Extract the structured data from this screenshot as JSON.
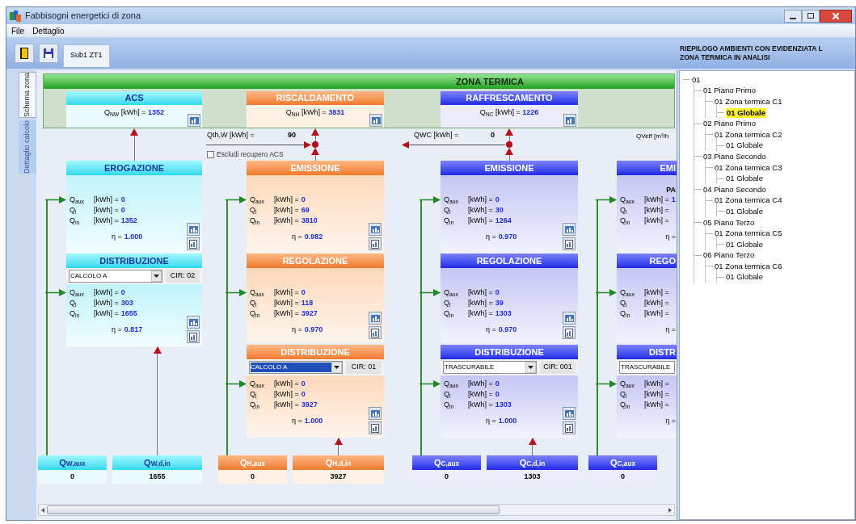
{
  "window": {
    "title": "Fabbisogni energetici di zona"
  },
  "menu": [
    "File",
    "Dettaglio"
  ],
  "toolbar": {
    "tabs": [
      {
        "label": "Sub1 ZT1",
        "selected": true
      }
    ]
  },
  "tree_title": [
    "RIEPILOGO AMBIENTI CON EVIDENZIATA L",
    "ZONA TERMICA IN ANALISI"
  ],
  "side_tabs": [
    {
      "label": "Schema zona",
      "selected": true
    },
    {
      "label": "Dettaglio calcolo",
      "selected": false
    }
  ],
  "zone_header": "ZONA TERMICA",
  "links": {
    "heating": {
      "label": "Qth,W [kWh] =",
      "value": "90"
    },
    "cooling": {
      "label": "QWC [kWh] =",
      "value": "0"
    },
    "ventilation": {
      "label": "QVeff [m³/h"
    }
  },
  "exclude_checkbox": {
    "label": "Escludi recupero ACS",
    "checked": false
  },
  "columns": [
    {
      "kind": "acs",
      "summary": {
        "title": "ACS",
        "label": "Q$_{NW}$ [kWh] =",
        "value": "1352"
      },
      "sections": [
        {
          "title": "EROGAZIONE",
          "rows": [
            {
              "q": "Q$_{aux}$",
              "unit": "[kWh] =",
              "value": "0"
            },
            {
              "q": "Q$_{l}$",
              "unit": "[kWh] =",
              "value": "0"
            },
            {
              "q": "Q$_{in}$",
              "unit": "[kWh] =",
              "value": "1352"
            }
          ],
          "eta": {
            "label": "η =",
            "value": "1.000"
          }
        },
        {
          "title": "DISTRIBUZIONE",
          "select": {
            "value": "CALCOLO A",
            "highlighted": false
          },
          "circuit": "CIR: 02",
          "rows": [
            {
              "q": "Q$_{aux}$",
              "unit": "[kWh] =",
              "value": "0"
            },
            {
              "q": "Q$_{l}$",
              "unit": "[kWh] =",
              "value": "303"
            },
            {
              "q": "Q$_{in}$",
              "unit": "[kWh] =",
              "value": "1655"
            }
          ],
          "eta": {
            "label": "η =",
            "value": "0.817"
          }
        }
      ],
      "totals": [
        {
          "label": "Q$_{W,aux}$",
          "value": "0"
        },
        {
          "label": "Q$_{W,d,in}$",
          "value": "1655"
        }
      ]
    },
    {
      "kind": "heating",
      "summary": {
        "title": "RISCALDAMENTO",
        "label": "Q$_{NH}$ [kWh] =",
        "value": "3831"
      },
      "sections": [
        {
          "title": "EMISSIONE",
          "rows": [
            {
              "q": "Q$_{aux}$",
              "unit": "[kWh] =",
              "value": "0"
            },
            {
              "q": "Q$_{l}$",
              "unit": "[kWh] =",
              "value": "69"
            },
            {
              "q": "Q$_{in}$",
              "unit": "[kWh] =",
              "value": "3810"
            }
          ],
          "eta": {
            "label": "η =",
            "value": "0.982"
          }
        },
        {
          "title": "REGOLAZIONE",
          "rows": [
            {
              "q": "Q$_{aux}$",
              "unit": "[kWh] =",
              "value": "0"
            },
            {
              "q": "Q$_{l}$",
              "unit": "[kWh] =",
              "value": "118"
            },
            {
              "q": "Q$_{in}$",
              "unit": "[kWh] =",
              "value": "3927"
            }
          ],
          "eta": {
            "label": "η =",
            "value": "0.970"
          }
        },
        {
          "title": "DISTRIBUZIONE",
          "select": {
            "value": "CALCOLO A",
            "highlighted": true
          },
          "circuit": "CIR: 01",
          "rows": [
            {
              "q": "Q$_{aux}$",
              "unit": "[kWh] =",
              "value": "0"
            },
            {
              "q": "Q$_{l}$",
              "unit": "[kWh] =",
              "value": "0"
            },
            {
              "q": "Q$_{in}$",
              "unit": "[kWh] =",
              "value": "3927"
            }
          ],
          "eta": {
            "label": "η =",
            "value": "1.000"
          }
        }
      ],
      "totals": [
        {
          "label": "Q$_{H,aux}$",
          "value": "0"
        },
        {
          "label": "Q$_{H,d,in}$",
          "value": "3927"
        }
      ]
    },
    {
      "kind": "cooling",
      "summary": {
        "title": "RAFFRESCAMENTO",
        "label": "Q$_{NC}$ [kWh] =",
        "value": "1226"
      },
      "sections": [
        {
          "title": "EMISSIONE",
          "rows": [
            {
              "q": "Q$_{aux}$",
              "unit": "[kWh] =",
              "value": "0"
            },
            {
              "q": "Q$_{l}$",
              "unit": "[kWh] =",
              "value": "30"
            },
            {
              "q": "Q$_{in}$",
              "unit": "[kWh] =",
              "value": "1264"
            }
          ],
          "eta": {
            "label": "η =",
            "value": "0.970"
          }
        },
        {
          "title": "REGOLAZIONE",
          "rows": [
            {
              "q": "Q$_{aux}$",
              "unit": "[kWh] =",
              "value": "0"
            },
            {
              "q": "Q$_{l}$",
              "unit": "[kWh] =",
              "value": "39"
            },
            {
              "q": "Q$_{in}$",
              "unit": "[kWh] =",
              "value": "1303"
            }
          ],
          "eta": {
            "label": "η =",
            "value": "0.970"
          }
        },
        {
          "title": "DISTRIBUZIONE",
          "select": {
            "value": "TRASCURABILE",
            "highlighted": false
          },
          "circuit": "CIR: 001",
          "rows": [
            {
              "q": "Q$_{aux}$",
              "unit": "[kWh] =",
              "value": "0"
            },
            {
              "q": "Q$_{l}$",
              "unit": "[kWh] =",
              "value": "0"
            },
            {
              "q": "Q$_{in}$",
              "unit": "[kWh] =",
              "value": "1303"
            }
          ],
          "eta": {
            "label": "η =",
            "value": "1.000"
          }
        }
      ],
      "totals": [
        {
          "label": "Q$_{C,aux}$",
          "value": "0"
        },
        {
          "label": "Q$_{C,d,in}$",
          "value": "1303"
        }
      ]
    },
    {
      "kind": "cooling",
      "sections": [
        {
          "title": "EMI",
          "note": "PA",
          "rows": [
            {
              "q": "Q$_{aux}$",
              "unit": "[kWh] =",
              "value": "1"
            },
            {
              "q": "Q$_{l}$",
              "unit": "[kWh] ="
            },
            {
              "q": "Q$_{in}$",
              "unit": "[kWh] ="
            }
          ],
          "eta": {
            "label": "η ="
          }
        },
        {
          "title": "REGO",
          "rows": [
            {
              "q": "Q$_{aux}$",
              "unit": "[kWh] ="
            },
            {
              "q": "Q$_{l}$",
              "unit": "[kWh] ="
            },
            {
              "q": "Q$_{in}$",
              "unit": "[kWh] ="
            }
          ],
          "eta": {
            "label": "η ="
          }
        },
        {
          "title": "DISTR",
          "select": {
            "value": "TRASCURABILE",
            "highlighted": false
          },
          "rows": [
            {
              "q": "Q$_{aux}$",
              "unit": "[kWh] ="
            },
            {
              "q": "Q$_{l}$",
              "unit": "[kWh] ="
            },
            {
              "q": "Q$_{in}$",
              "unit": "[kWh] ="
            }
          ],
          "eta": {
            "label": "η ="
          }
        }
      ],
      "totals": [
        {
          "label": "Q$_{C,aux}$",
          "value": "0"
        }
      ]
    }
  ],
  "tree": [
    {
      "label": "01",
      "selected": false,
      "children": [
        {
          "label": "01 Piano Primo",
          "selected": false,
          "children": [
            {
              "label": "01 Zona termica C1",
              "selected": false,
              "children": [
                {
                  "label": "01 Globale",
                  "selected": true
                }
              ]
            }
          ]
        },
        {
          "label": "02 Piano Primo",
          "selected": false,
          "children": [
            {
              "label": "01 Zona termica C2",
              "selected": false,
              "children": [
                {
                  "label": "01 Globale",
                  "selected": false
                }
              ]
            }
          ]
        },
        {
          "label": "03 Piano Secondo",
          "selected": false,
          "children": [
            {
              "label": "01 Zona termica C3",
              "selected": false,
              "children": [
                {
                  "label": "01 Globale",
                  "selected": false
                }
              ]
            }
          ]
        },
        {
          "label": "04 Piano Secondo",
          "selected": false,
          "children": [
            {
              "label": "01 Zona termica C4",
              "selected": false,
              "children": [
                {
                  "label": "01 Globale",
                  "selected": false
                }
              ]
            }
          ]
        },
        {
          "label": "05 Piano Terzo",
          "selected": false,
          "children": [
            {
              "label": "01 Zona termica C5",
              "selected": false,
              "children": [
                {
                  "label": "01 Globale",
                  "selected": false
                }
              ]
            }
          ]
        },
        {
          "label": "06 Piano Terzo",
          "selected": false,
          "children": [
            {
              "label": "01 Zona termica C6",
              "selected": false,
              "children": [
                {
                  "label": "01 Globale",
                  "selected": false
                }
              ]
            }
          ]
        }
      ]
    }
  ]
}
